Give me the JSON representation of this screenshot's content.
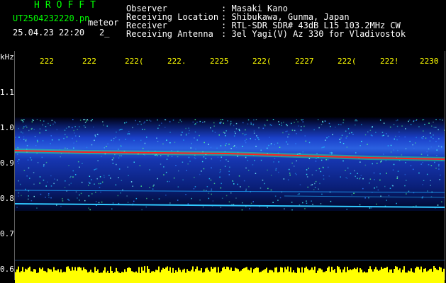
{
  "header": {
    "logo": "HROFFT",
    "filename": "UT2504232220.pn",
    "tag": "meteor",
    "datetime": "25.04.23 22:20",
    "extra": "2_",
    "fields": [
      {
        "label": "Observer",
        "value": ": Masaki Kano"
      },
      {
        "label": "Receiving Location",
        "value": ": Shibukawa, Gunma, Japan"
      },
      {
        "label": "Receiver",
        "value": ": RTL-SDR SDR# 43dB L15 103.2MHz CW"
      },
      {
        "label": "Receiving Antenna",
        "value": ": 3el Yagi(V) Az 330 for Vladivostok"
      }
    ]
  },
  "axis": {
    "unit": "kHz",
    "y_labels": [
      "1.1",
      "1.0",
      "0.9",
      "0.8",
      "0.7",
      "0.6"
    ],
    "x_labels": [
      "222",
      "222",
      "222(",
      "222.",
      "2225",
      "222(",
      "2227",
      "222(",
      "222!",
      "2230"
    ]
  },
  "colors": {
    "signal": "#ff2020",
    "noise_band": "#1030c0",
    "meteor_lines": "#20c0ff",
    "bottom_strip": "#ffff00",
    "text_primary": "#00ff00",
    "text_secondary": "#ffffff",
    "ticks": "#ffff00"
  }
}
